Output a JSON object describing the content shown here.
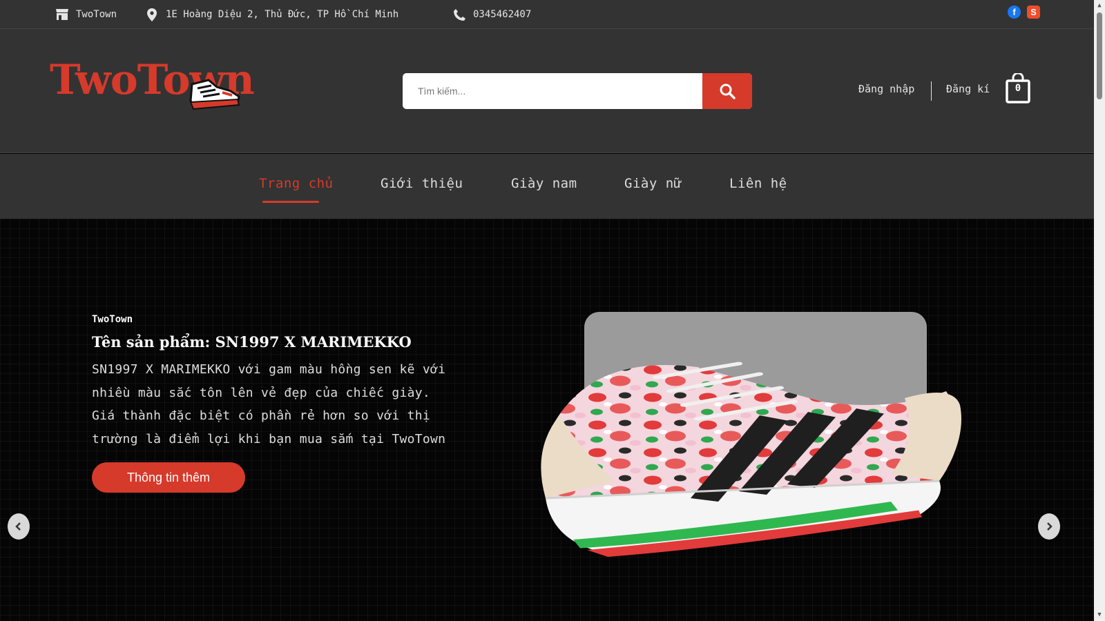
{
  "topbar": {
    "store_name": "TwoTown",
    "address": "1E Hoàng Diệu 2, Thủ Đức, TP Hồ Chí Minh",
    "phone": "0345462407",
    "social": [
      "facebook",
      "shopee"
    ]
  },
  "header": {
    "logo_text": "TwoTown",
    "search_placeholder": "Tìm kiếm...",
    "login_label": "Đăng nhập",
    "register_label": "Đăng kí",
    "cart_count": "0"
  },
  "nav": {
    "items": [
      {
        "label": "Trang chủ",
        "active": true
      },
      {
        "label": "Giới thiệu"
      },
      {
        "label": "Giày nam"
      },
      {
        "label": "Giày nữ"
      },
      {
        "label": "Liên hệ"
      }
    ]
  },
  "hero": {
    "brand": "TwoTown",
    "title": "Tên sản phẩm: SN1997 X MARIMEKKO",
    "description_lines": [
      "SN1997 X MARIMEKKO với gam màu hồng sen kẽ với",
      "nhiều màu sắc tôn lên vẻ đẹp của chiếc giày.",
      "Giá thành đặc biệt có phần rẻ hơn so với thị",
      "trường là điểm lợi khi bạn mua sắm tại TwoTown"
    ],
    "button_label": "Thông tin thêm"
  },
  "colors": {
    "accent": "#d63a2a",
    "bar_bg": "#333333",
    "hero_bg": "#050505"
  }
}
